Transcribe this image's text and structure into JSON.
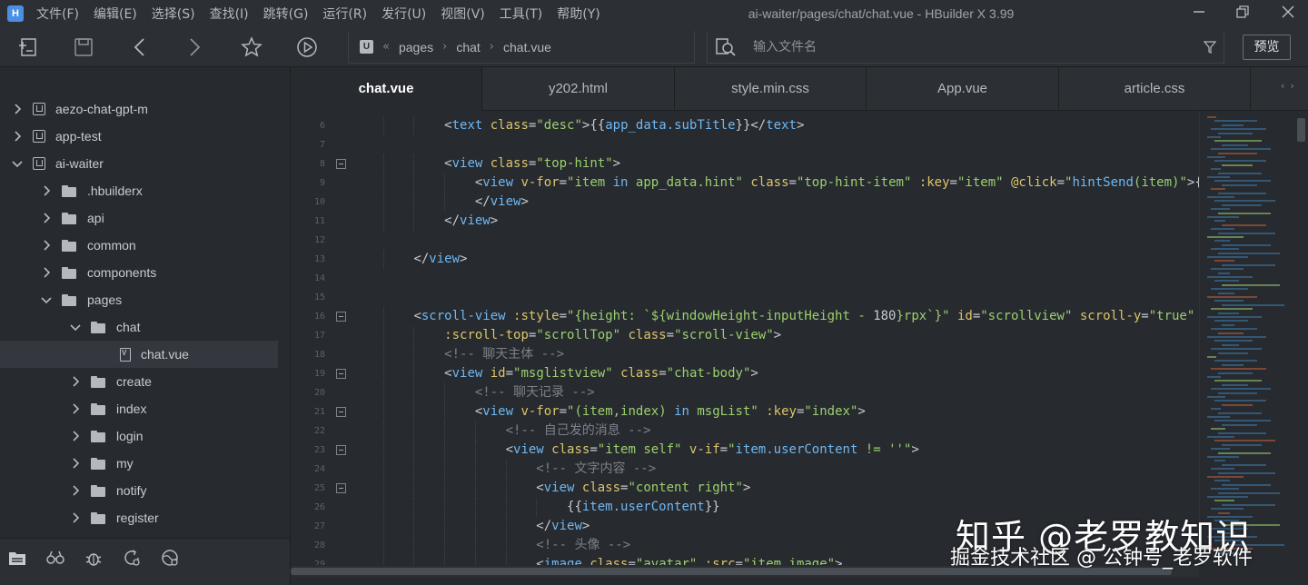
{
  "app": {
    "logo_letter": "H",
    "window_title": "ai-waiter/pages/chat/chat.vue - HBuilder X 3.99",
    "menu": [
      "文件(F)",
      "编辑(E)",
      "选择(S)",
      "查找(I)",
      "跳转(G)",
      "运行(R)",
      "发行(U)",
      "视图(V)",
      "工具(T)",
      "帮助(Y)"
    ]
  },
  "toolbar": {
    "breadcrumb": [
      "pages",
      "chat",
      "chat.vue"
    ],
    "search_placeholder": "输入文件名",
    "preview_label": "预览"
  },
  "sidebar": {
    "items": [
      {
        "label": "aezo-chat-gpt-m",
        "kind": "project",
        "depth": 0,
        "expanded": false
      },
      {
        "label": "app-test",
        "kind": "project",
        "depth": 0,
        "expanded": false
      },
      {
        "label": "ai-waiter",
        "kind": "project",
        "depth": 0,
        "expanded": true
      },
      {
        "label": ".hbuilderx",
        "kind": "folder",
        "depth": 1,
        "expanded": false
      },
      {
        "label": "api",
        "kind": "folder",
        "depth": 1,
        "expanded": false
      },
      {
        "label": "common",
        "kind": "folder",
        "depth": 1,
        "expanded": false
      },
      {
        "label": "components",
        "kind": "folder",
        "depth": 1,
        "expanded": false
      },
      {
        "label": "pages",
        "kind": "folder",
        "depth": 1,
        "expanded": true
      },
      {
        "label": "chat",
        "kind": "folder",
        "depth": 2,
        "expanded": true
      },
      {
        "label": "chat.vue",
        "kind": "file",
        "depth": 3,
        "selected": true
      },
      {
        "label": "create",
        "kind": "folder",
        "depth": 2,
        "expanded": false
      },
      {
        "label": "index",
        "kind": "folder",
        "depth": 2,
        "expanded": false
      },
      {
        "label": "login",
        "kind": "folder",
        "depth": 2,
        "expanded": false
      },
      {
        "label": "my",
        "kind": "folder",
        "depth": 2,
        "expanded": false
      },
      {
        "label": "notify",
        "kind": "folder",
        "depth": 2,
        "expanded": false
      },
      {
        "label": "register",
        "kind": "folder",
        "depth": 2,
        "expanded": false
      }
    ]
  },
  "tabs": [
    {
      "label": "chat.vue",
      "active": true
    },
    {
      "label": "y202.html",
      "active": false
    },
    {
      "label": "style.min.css",
      "active": false
    },
    {
      "label": "App.vue",
      "active": false
    },
    {
      "label": "article.css",
      "active": false
    }
  ],
  "editor": {
    "lines": [
      {
        "n": "6",
        "fold": false,
        "tokens": [
          [
            "i",
            "            "
          ],
          [
            "p",
            "<"
          ],
          [
            "t",
            "text"
          ],
          [
            "p",
            " "
          ],
          [
            "a",
            "class"
          ],
          [
            "p",
            "="
          ],
          [
            "s",
            "\"desc\""
          ],
          [
            "p",
            ">{{"
          ],
          [
            "v",
            "app_data.subTitle"
          ],
          [
            "p",
            "}}</"
          ],
          [
            "t",
            "text"
          ],
          [
            "p",
            ">"
          ]
        ]
      },
      {
        "n": "7",
        "fold": false,
        "tokens": []
      },
      {
        "n": "8",
        "fold": true,
        "tokens": [
          [
            "i",
            "            "
          ],
          [
            "p",
            "<"
          ],
          [
            "t",
            "view"
          ],
          [
            "p",
            " "
          ],
          [
            "a",
            "class"
          ],
          [
            "p",
            "="
          ],
          [
            "s",
            "\"top-hint\""
          ],
          [
            "p",
            ">"
          ]
        ]
      },
      {
        "n": "9",
        "fold": false,
        "tokens": [
          [
            "i",
            "                "
          ],
          [
            "p",
            "<"
          ],
          [
            "t",
            "view"
          ],
          [
            "p",
            " "
          ],
          [
            "a",
            "v-for"
          ],
          [
            "p",
            "="
          ],
          [
            "s",
            "\"item "
          ],
          [
            "t",
            "in"
          ],
          [
            "s",
            " app_data.hint\""
          ],
          [
            "p",
            " "
          ],
          [
            "a",
            "class"
          ],
          [
            "p",
            "="
          ],
          [
            "s",
            "\"top-hint-item\""
          ],
          [
            "p",
            " "
          ],
          [
            "a",
            ":key"
          ],
          [
            "p",
            "="
          ],
          [
            "s",
            "\"item\""
          ],
          [
            "p",
            " "
          ],
          [
            "a",
            "@click"
          ],
          [
            "p",
            "="
          ],
          [
            "s",
            "\""
          ],
          [
            "v",
            "hintSend"
          ],
          [
            "s",
            "(item)\""
          ],
          [
            "p",
            ">{{i"
          ]
        ]
      },
      {
        "n": "10",
        "fold": false,
        "tokens": [
          [
            "i",
            "                "
          ],
          [
            "p",
            "</"
          ],
          [
            "t",
            "view"
          ],
          [
            "p",
            ">"
          ]
        ]
      },
      {
        "n": "11",
        "fold": false,
        "tokens": [
          [
            "i",
            "            "
          ],
          [
            "p",
            "</"
          ],
          [
            "t",
            "view"
          ],
          [
            "p",
            ">"
          ]
        ]
      },
      {
        "n": "12",
        "fold": false,
        "tokens": []
      },
      {
        "n": "13",
        "fold": false,
        "tokens": [
          [
            "i",
            "        "
          ],
          [
            "p",
            "</"
          ],
          [
            "t",
            "view"
          ],
          [
            "p",
            ">"
          ]
        ]
      },
      {
        "n": "14",
        "fold": false,
        "tokens": []
      },
      {
        "n": "15",
        "fold": false,
        "tokens": []
      },
      {
        "n": "16",
        "fold": true,
        "tokens": [
          [
            "i",
            "        "
          ],
          [
            "p",
            "<"
          ],
          [
            "t",
            "scroll-view"
          ],
          [
            "p",
            " "
          ],
          [
            "a",
            ":style"
          ],
          [
            "p",
            "="
          ],
          [
            "s",
            "\"{height: `${windowHeight-inputHeight - "
          ],
          [
            "p",
            "180"
          ],
          [
            "s",
            "}rpx`}\""
          ],
          [
            "p",
            " "
          ],
          [
            "a",
            "id"
          ],
          [
            "p",
            "="
          ],
          [
            "s",
            "\"scrollview\""
          ],
          [
            "p",
            " "
          ],
          [
            "a",
            "scroll-y"
          ],
          [
            "p",
            "="
          ],
          [
            "s",
            "\"true\""
          ]
        ]
      },
      {
        "n": "17",
        "fold": false,
        "tokens": [
          [
            "i",
            "            "
          ],
          [
            "a",
            ":scroll-top"
          ],
          [
            "p",
            "="
          ],
          [
            "s",
            "\"scrollTop\""
          ],
          [
            "p",
            " "
          ],
          [
            "a",
            "class"
          ],
          [
            "p",
            "="
          ],
          [
            "s",
            "\"scroll-view\""
          ],
          [
            "p",
            ">"
          ]
        ]
      },
      {
        "n": "18",
        "fold": false,
        "tokens": [
          [
            "i",
            "            "
          ],
          [
            "c",
            "<!-- 聊天主体 -->"
          ]
        ]
      },
      {
        "n": "19",
        "fold": true,
        "tokens": [
          [
            "i",
            "            "
          ],
          [
            "p",
            "<"
          ],
          [
            "t",
            "view"
          ],
          [
            "p",
            " "
          ],
          [
            "a",
            "id"
          ],
          [
            "p",
            "="
          ],
          [
            "s",
            "\"msglistview\""
          ],
          [
            "p",
            " "
          ],
          [
            "a",
            "class"
          ],
          [
            "p",
            "="
          ],
          [
            "s",
            "\"chat-body\""
          ],
          [
            "p",
            ">"
          ]
        ]
      },
      {
        "n": "20",
        "fold": false,
        "tokens": [
          [
            "i",
            "                "
          ],
          [
            "c",
            "<!-- 聊天记录 -->"
          ]
        ]
      },
      {
        "n": "21",
        "fold": true,
        "tokens": [
          [
            "i",
            "                "
          ],
          [
            "p",
            "<"
          ],
          [
            "t",
            "view"
          ],
          [
            "p",
            " "
          ],
          [
            "a",
            "v-for"
          ],
          [
            "p",
            "="
          ],
          [
            "s",
            "\"(item,index) "
          ],
          [
            "t",
            "in"
          ],
          [
            "s",
            " msgList\""
          ],
          [
            "p",
            " "
          ],
          [
            "a",
            ":key"
          ],
          [
            "p",
            "="
          ],
          [
            "s",
            "\"index\""
          ],
          [
            "p",
            ">"
          ]
        ]
      },
      {
        "n": "22",
        "fold": false,
        "tokens": [
          [
            "i",
            "                    "
          ],
          [
            "c",
            "<!-- 自己发的消息 -->"
          ]
        ]
      },
      {
        "n": "23",
        "fold": true,
        "tokens": [
          [
            "i",
            "                    "
          ],
          [
            "p",
            "<"
          ],
          [
            "t",
            "view"
          ],
          [
            "p",
            " "
          ],
          [
            "a",
            "class"
          ],
          [
            "p",
            "="
          ],
          [
            "s",
            "\"item self\""
          ],
          [
            "p",
            " "
          ],
          [
            "a",
            "v-if"
          ],
          [
            "p",
            "="
          ],
          [
            "s",
            "\""
          ],
          [
            "v",
            "item.userContent"
          ],
          [
            "s",
            " != ''\""
          ],
          [
            "p",
            ">"
          ]
        ]
      },
      {
        "n": "24",
        "fold": false,
        "tokens": [
          [
            "i",
            "                        "
          ],
          [
            "c",
            "<!-- 文字内容 -->"
          ]
        ]
      },
      {
        "n": "25",
        "fold": true,
        "tokens": [
          [
            "i",
            "                        "
          ],
          [
            "p",
            "<"
          ],
          [
            "t",
            "view"
          ],
          [
            "p",
            " "
          ],
          [
            "a",
            "class"
          ],
          [
            "p",
            "="
          ],
          [
            "s",
            "\"content right\""
          ],
          [
            "p",
            ">"
          ]
        ]
      },
      {
        "n": "26",
        "fold": false,
        "tokens": [
          [
            "i",
            "                            "
          ],
          [
            "p",
            "{{"
          ],
          [
            "v",
            "item.userContent"
          ],
          [
            "p",
            "}}"
          ]
        ]
      },
      {
        "n": "27",
        "fold": false,
        "tokens": [
          [
            "i",
            "                        "
          ],
          [
            "p",
            "</"
          ],
          [
            "t",
            "view"
          ],
          [
            "p",
            ">"
          ]
        ]
      },
      {
        "n": "28",
        "fold": false,
        "tokens": [
          [
            "i",
            "                        "
          ],
          [
            "c",
            "<!-- 头像 -->"
          ]
        ]
      },
      {
        "n": "29",
        "fold": false,
        "tokens": [
          [
            "i",
            "                        "
          ],
          [
            "p",
            "<"
          ],
          [
            "t",
            "image"
          ],
          [
            "p",
            " "
          ],
          [
            "a",
            "class"
          ],
          [
            "p",
            "="
          ],
          [
            "s",
            "\"avatar\""
          ],
          [
            "p",
            " "
          ],
          [
            "a",
            ":src"
          ],
          [
            "p",
            "="
          ],
          [
            "s",
            "\"item.image\""
          ],
          [
            "p",
            ">"
          ]
        ]
      }
    ]
  },
  "watermark": {
    "line1": "知乎 @老罗教知识",
    "line2": "掘金技术社区 @ 公钟号_老罗软件"
  },
  "colors": {
    "accent": "#4a90e2",
    "tag": "#6fb8f2",
    "attr": "#dcc56a",
    "string": "#9bd06e",
    "comment": "#7d8189"
  }
}
